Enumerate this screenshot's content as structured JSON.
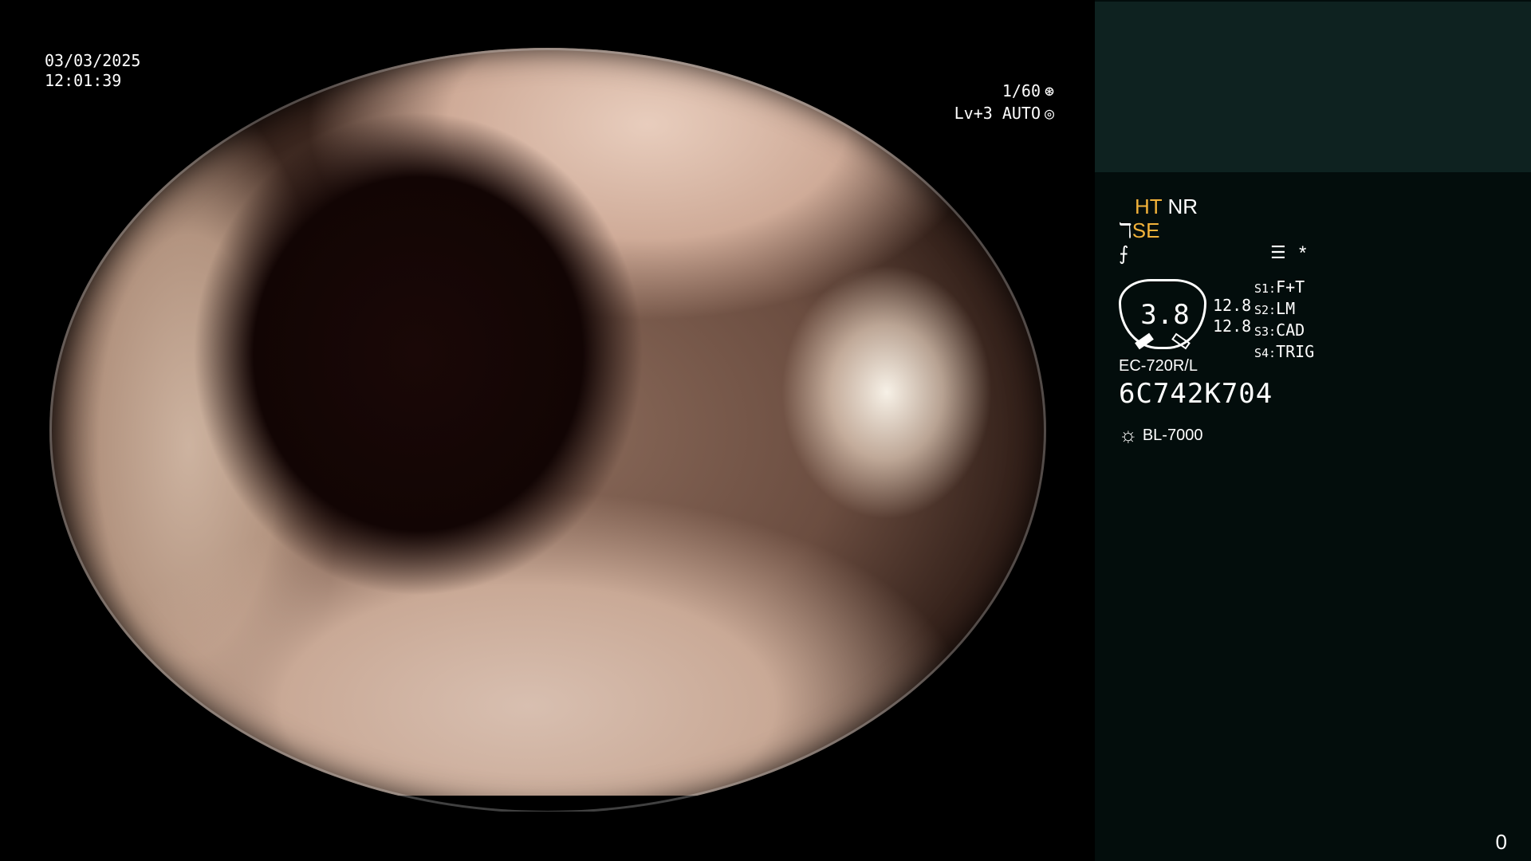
{
  "overlay": {
    "date": "03/03/2025",
    "time": "12:01:39",
    "shutter": "1/60",
    "shutter_icon": "aperture-icon",
    "iris": "Lv+3 AUTO",
    "iris_icon": "iris-icon"
  },
  "panel": {
    "ht": "HT",
    "nr": "NR",
    "se": "SE",
    "se_icon": "scope-enhance-icon",
    "enh_icon": "enhancement-icon",
    "menu_icon": "menu-icon",
    "star": "*",
    "gauge_value": "3.8",
    "gauge_a": "12.8",
    "gauge_b": "12.8",
    "switches": [
      {
        "key": "S1:",
        "value": "F+T"
      },
      {
        "key": "S2:",
        "value": "LM"
      },
      {
        "key": "S3:",
        "value": "CAD"
      },
      {
        "key": "S4:",
        "value": "TRIG"
      }
    ],
    "model": "EC-720R/L",
    "serial": "6C742K704",
    "lamp": "BL-7000",
    "lamp_icon": "light-source-icon",
    "counter": "0"
  },
  "colors": {
    "panel_bg": "#030d0c",
    "panel_top_bg": "#0e2220",
    "amber": "#f2b23a"
  }
}
